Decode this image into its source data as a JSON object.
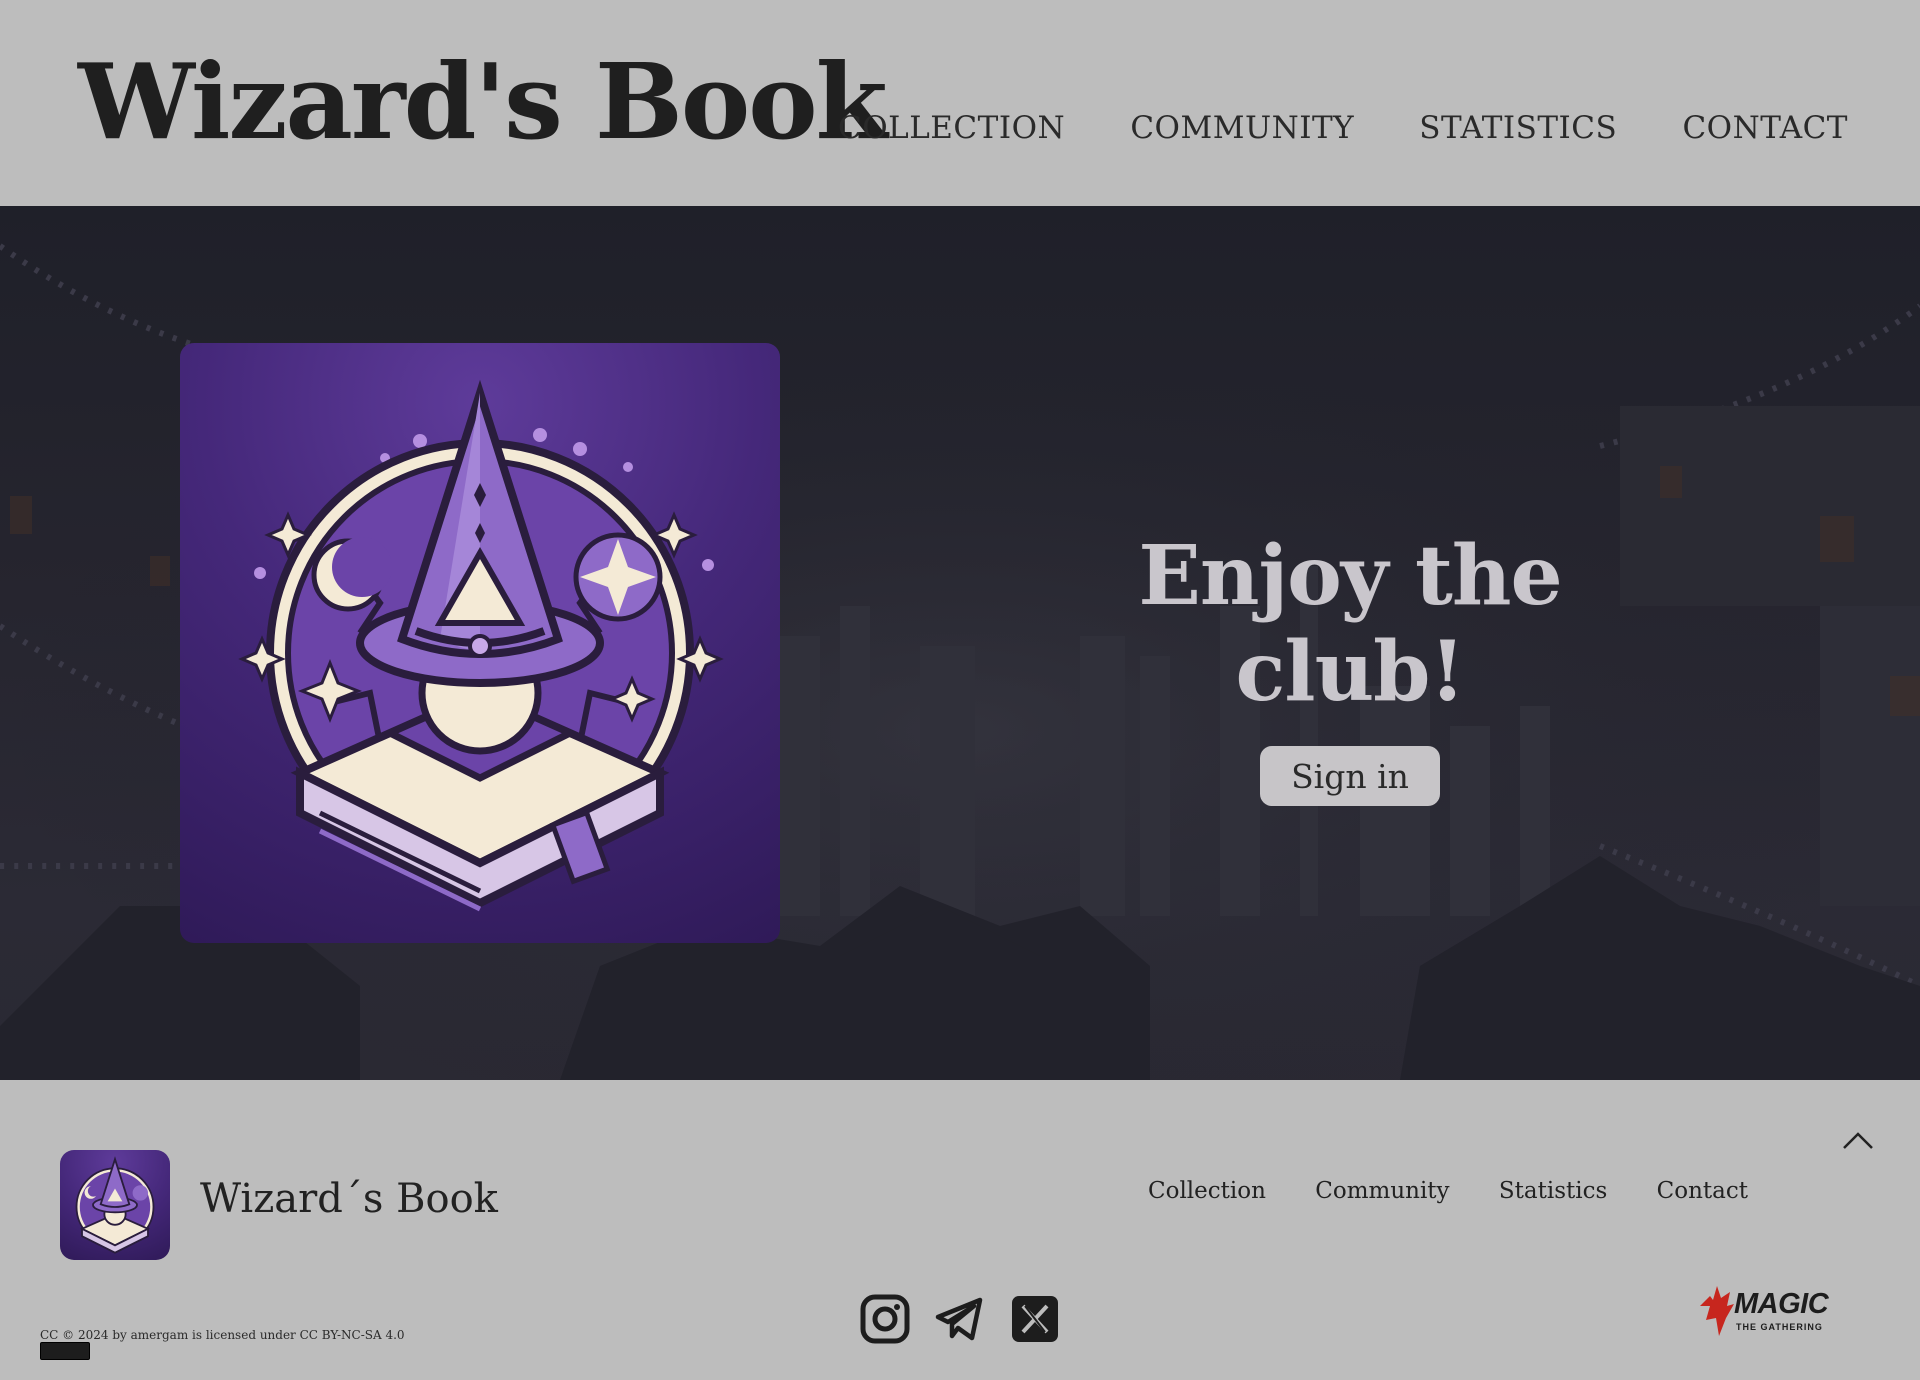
{
  "header": {
    "brand": "Wizard's Book",
    "nav": [
      "COLLECTION",
      "COMMUNITY",
      "STATISTICS",
      "CONTACT"
    ]
  },
  "hero": {
    "tagline": "Enjoy the club!",
    "signin_label": "Sign in"
  },
  "footer": {
    "brand": "Wizard´s Book",
    "nav": [
      "Collection",
      "Community",
      "Statistics",
      "Contact"
    ],
    "social": [
      "instagram-icon",
      "telegram-icon",
      "x-icon"
    ],
    "license": "CC © 2024 by amergam is licensed under CC BY-NC-SA 4.0",
    "partner": {
      "name": "MAGIC",
      "sub": "THE GATHERING"
    }
  },
  "colors": {
    "background": "#bdbdbd",
    "hero_dark": "#23232c",
    "brand_purple": "#45287a",
    "text_dark": "#222222"
  }
}
